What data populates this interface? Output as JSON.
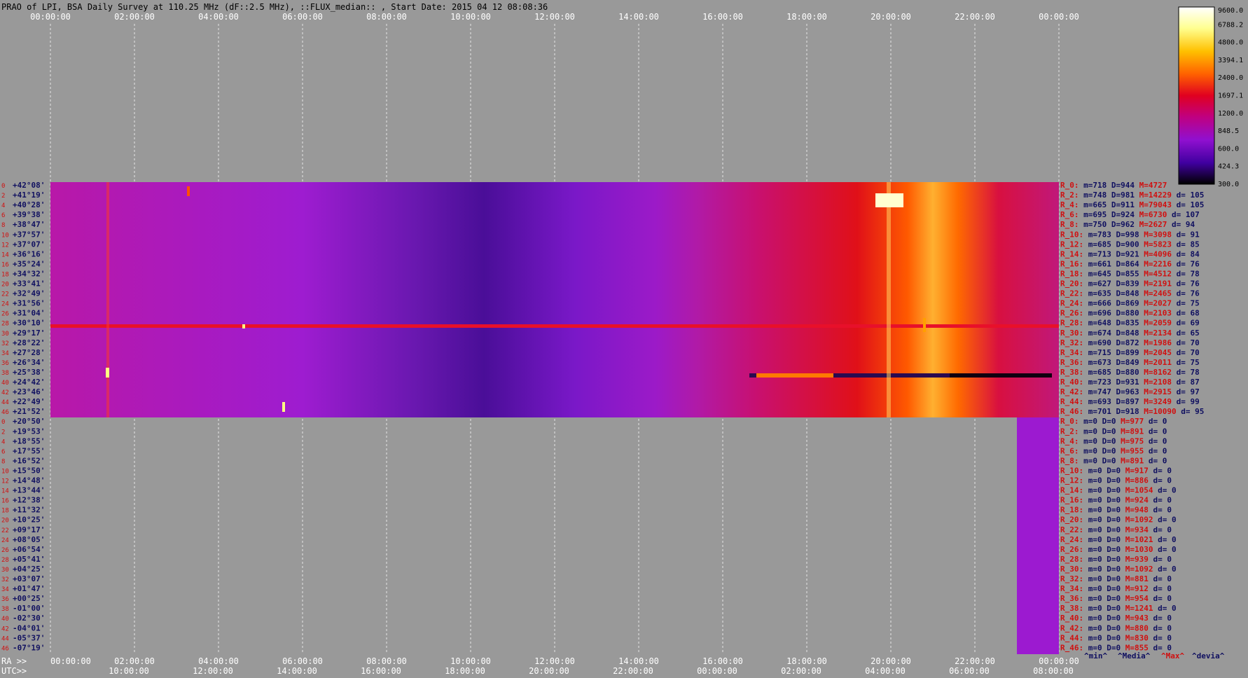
{
  "header": {
    "title": "PRAO of LPI, BSA Daily Survey at 110.25 MHz (dF::2.5 MHz), ::FLUX_median:: , Start Date: 2015 04 12 08:08:36"
  },
  "chart_data": {
    "type": "heatmap",
    "title": "PRAO of LPI, BSA Daily Survey at 110.25 MHz (dF::2.5 MHz), ::FLUX_median:: , Start Date: 2015 04 12 08:08:36",
    "xaxis_top_labels": [
      "00:00:00",
      "02:00:00",
      "04:00:00",
      "06:00:00",
      "08:00:00",
      "10:00:00",
      "12:00:00",
      "14:00:00",
      "16:00:00",
      "18:00:00",
      "20:00:00",
      "22:00:00",
      "00:00:00"
    ],
    "xaxis_bottom_ra_prefix": "RA >>",
    "xaxis_bottom_ra_labels": [
      "00:00:00",
      "02:00:00",
      "04:00:00",
      "06:00:00",
      "08:00:00",
      "10:00:00",
      "12:00:00",
      "14:00:00",
      "16:00:00",
      "18:00:00",
      "20:00:00",
      "22:00:00",
      "00:00:00"
    ],
    "xaxis_bottom_utc_prefix": "UTC>>",
    "xaxis_bottom_utc_labels": [
      "10:00:00",
      "12:00:00",
      "14:00:00",
      "16:00:00",
      "18:00:00",
      "20:00:00",
      "22:00:00",
      "00:00:00",
      "02:00:00",
      "04:00:00",
      "06:00:00",
      "08:00:00"
    ],
    "beam_indices": [
      "0",
      "2",
      "4",
      "6",
      "8",
      "10",
      "12",
      "14",
      "16",
      "18",
      "20",
      "22",
      "24",
      "26",
      "28",
      "30",
      "32",
      "34",
      "36",
      "38",
      "40",
      "42",
      "44",
      "46",
      "0",
      "2",
      "4",
      "6",
      "8",
      "10",
      "12",
      "14",
      "16",
      "18",
      "20",
      "22",
      "24",
      "26",
      "28",
      "30",
      "32",
      "34",
      "36",
      "38",
      "40",
      "42",
      "44",
      "46"
    ],
    "declinations": [
      "+42°08'",
      "+41°19'",
      "+40°28'",
      "+39°38'",
      "+38°47'",
      "+37°57'",
      "+37°07'",
      "+36°16'",
      "+35°24'",
      "+34°32'",
      "+33°41'",
      "+32°49'",
      "+31°56'",
      "+31°04'",
      "+30°10'",
      "+29°17'",
      "+28°22'",
      "+27°28'",
      "+26°34'",
      "+25°38'",
      "+24°42'",
      "+23°46'",
      "+22°49'",
      "+21°52'",
      "+20°50'",
      "+19°53'",
      "+18°55'",
      "+17°55'",
      "+16°52'",
      "+15°50'",
      "+14°48'",
      "+13°44'",
      "+12°38'",
      "+11°32'",
      "+10°25'",
      "+09°17'",
      "+08°05'",
      "+06°54'",
      "+05°41'",
      "+04°25'",
      "+03°07'",
      "+01°47'",
      "+00°25'",
      "-01°00'",
      "-02°30'",
      "-04°01'",
      "-05°37'",
      "-07°19'"
    ],
    "colorbar": {
      "ticks": [
        "9600.0",
        "6788.2",
        "4800.0",
        "3394.1",
        "2400.0",
        "1697.1",
        "1200.0",
        "848.5",
        "600.0",
        "424.3",
        "300.0"
      ],
      "colors": [
        "#ffffff",
        "#ffff90",
        "#ffc000",
        "#ff6000",
        "#e00020",
        "#c00080",
        "#9010d0",
        "#4000a0",
        "#000000"
      ]
    },
    "stats_block1": [
      {
        "label": "R_0:",
        "m": "m=718",
        "D": "D=944",
        "M": "M=4727",
        "d": ""
      },
      {
        "label": "R_2:",
        "m": "m=748",
        "D": "D=981",
        "M": "M=14229",
        "d": "d= 105"
      },
      {
        "label": "R_4:",
        "m": "m=665",
        "D": "D=911",
        "M": "M=79043",
        "d": "d= 105"
      },
      {
        "label": "R_6:",
        "m": "m=695",
        "D": "D=924",
        "M": "M=6730",
        "d": "d= 107"
      },
      {
        "label": "R_8:",
        "m": "m=750",
        "D": "D=962",
        "M": "M=2627",
        "d": "d= 94"
      },
      {
        "label": "R_10:",
        "m": "m=783",
        "D": "D=998",
        "M": "M=3098",
        "d": "d= 91"
      },
      {
        "label": "R_12:",
        "m": "m=685",
        "D": "D=900",
        "M": "M=5823",
        "d": "d= 85"
      },
      {
        "label": "R_14:",
        "m": "m=713",
        "D": "D=921",
        "M": "M=4096",
        "d": "d= 84"
      },
      {
        "label": "R_16:",
        "m": "m=661",
        "D": "D=864",
        "M": "M=2216",
        "d": "d= 76"
      },
      {
        "label": "R_18:",
        "m": "m=645",
        "D": "D=855",
        "M": "M=4512",
        "d": "d= 78"
      },
      {
        "label": "R_20:",
        "m": "m=627",
        "D": "D=839",
        "M": "M=2191",
        "d": "d= 76"
      },
      {
        "label": "R_22:",
        "m": "m=635",
        "D": "D=848",
        "M": "M=2465",
        "d": "d= 76"
      },
      {
        "label": "R_24:",
        "m": "m=666",
        "D": "D=869",
        "M": "M=2027",
        "d": "d= 75"
      },
      {
        "label": "R_26:",
        "m": "m=696",
        "D": "D=880",
        "M": "M=2103",
        "d": "d= 68"
      },
      {
        "label": "R_28:",
        "m": "m=648",
        "D": "D=835",
        "M": "M=2059",
        "d": "d= 69"
      },
      {
        "label": "R_30:",
        "m": "m=674",
        "D": "D=848",
        "M": "M=2134",
        "d": "d= 65"
      },
      {
        "label": "R_32:",
        "m": "m=690",
        "D": "D=872",
        "M": "M=1986",
        "d": "d= 70"
      },
      {
        "label": "R_34:",
        "m": "m=715",
        "D": "D=899",
        "M": "M=2045",
        "d": "d= 70"
      },
      {
        "label": "R_36:",
        "m": "m=673",
        "D": "D=849",
        "M": "M=2011",
        "d": "d= 75"
      },
      {
        "label": "R_38:",
        "m": "m=685",
        "D": "D=880",
        "M": "M=8162",
        "d": "d= 78"
      },
      {
        "label": "R_40:",
        "m": "m=723",
        "D": "D=931",
        "M": "M=2108",
        "d": "d= 87"
      },
      {
        "label": "R_42:",
        "m": "m=747",
        "D": "D=963",
        "M": "M=2915",
        "d": "d= 97"
      },
      {
        "label": "R_44:",
        "m": "m=693",
        "D": "D=897",
        "M": "M=3249",
        "d": "d= 99"
      },
      {
        "label": "R_46:",
        "m": "m=701",
        "D": "D=918",
        "M": "M=10090",
        "d": "d= 95"
      }
    ],
    "stats_block2": [
      {
        "label": "R_0:",
        "m": "m=0",
        "D": "D=0",
        "M": "M=977",
        "d": "d= 0"
      },
      {
        "label": "R_2:",
        "m": "m=0",
        "D": "D=0",
        "M": "M=891",
        "d": "d= 0"
      },
      {
        "label": "R_4:",
        "m": "m=0",
        "D": "D=0",
        "M": "M=975",
        "d": "d= 0"
      },
      {
        "label": "R_6:",
        "m": "m=0",
        "D": "D=0",
        "M": "M=955",
        "d": "d= 0"
      },
      {
        "label": "R_8:",
        "m": "m=0",
        "D": "D=0",
        "M": "M=891",
        "d": "d= 0"
      },
      {
        "label": "R_10:",
        "m": "m=0",
        "D": "D=0",
        "M": "M=917",
        "d": "d= 0"
      },
      {
        "label": "R_12:",
        "m": "m=0",
        "D": "D=0",
        "M": "M=886",
        "d": "d= 0"
      },
      {
        "label": "R_14:",
        "m": "m=0",
        "D": "D=0",
        "M": "M=1054",
        "d": "d= 0"
      },
      {
        "label": "R_16:",
        "m": "m=0",
        "D": "D=0",
        "M": "M=924",
        "d": "d= 0"
      },
      {
        "label": "R_18:",
        "m": "m=0",
        "D": "D=0",
        "M": "M=948",
        "d": "d= 0"
      },
      {
        "label": "R_20:",
        "m": "m=0",
        "D": "D=0",
        "M": "M=1092",
        "d": "d= 0"
      },
      {
        "label": "R_22:",
        "m": "m=0",
        "D": "D=0",
        "M": "M=934",
        "d": "d= 0"
      },
      {
        "label": "R_24:",
        "m": "m=0",
        "D": "D=0",
        "M": "M=1021",
        "d": "d= 0"
      },
      {
        "label": "R_26:",
        "m": "m=0",
        "D": "D=0",
        "M": "M=1030",
        "d": "d= 0"
      },
      {
        "label": "R_28:",
        "m": "m=0",
        "D": "D=0",
        "M": "M=939",
        "d": "d= 0"
      },
      {
        "label": "R_30:",
        "m": "m=0",
        "D": "D=0",
        "M": "M=1092",
        "d": "d= 0"
      },
      {
        "label": "R_32:",
        "m": "m=0",
        "D": "D=0",
        "M": "M=881",
        "d": "d= 0"
      },
      {
        "label": "R_34:",
        "m": "m=0",
        "D": "D=0",
        "M": "M=912",
        "d": "d= 0"
      },
      {
        "label": "R_36:",
        "m": "m=0",
        "D": "D=0",
        "M": "M=954",
        "d": "d= 0"
      },
      {
        "label": "R_38:",
        "m": "m=0",
        "D": "D=0",
        "M": "M=1241",
        "d": "d= 0"
      },
      {
        "label": "R_40:",
        "m": "m=0",
        "D": "D=0",
        "M": "M=943",
        "d": "d= 0"
      },
      {
        "label": "R_42:",
        "m": "m=0",
        "D": "D=0",
        "M": "M=880",
        "d": "d= 0"
      },
      {
        "label": "R_44:",
        "m": "m=0",
        "D": "D=0",
        "M": "M=830",
        "d": "d= 0"
      },
      {
        "label": "R_46:",
        "m": "m=0",
        "D": "D=0",
        "M": "M=855",
        "d": "d= 0"
      }
    ],
    "stats_legend": [
      "^min^",
      "^Media^",
      "^Max^",
      "^devia^"
    ]
  }
}
